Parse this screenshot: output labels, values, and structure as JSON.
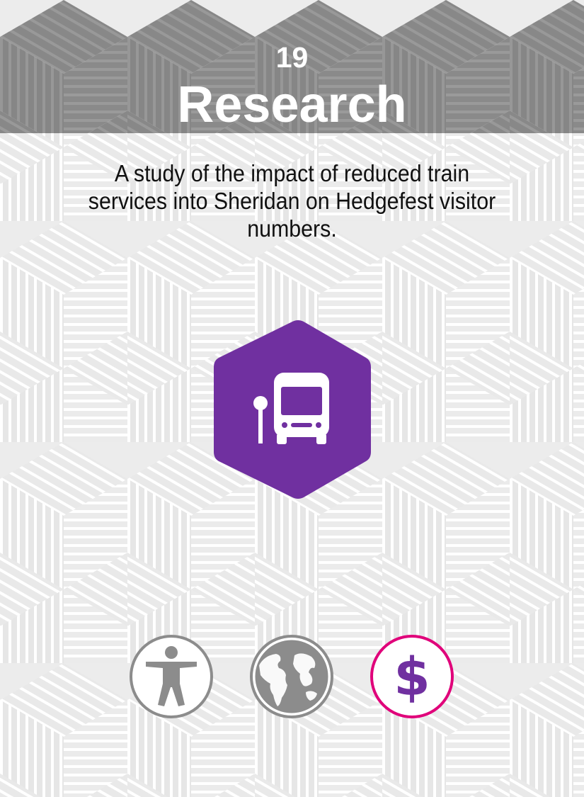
{
  "card": {
    "number": "19",
    "title": "Research",
    "description": "A study of the impact of reduced train services into Sheridan on Hedgefest visitor numbers."
  },
  "main_icon": {
    "name": "bus-stop-icon",
    "color": "#7030a0"
  },
  "category_icons": [
    {
      "name": "person-icon",
      "color": "#8c8c8c",
      "active": false
    },
    {
      "name": "globe-icon",
      "color": "#8c8c8c",
      "active": false
    },
    {
      "name": "dollar-icon",
      "color": "#e0007a",
      "glyph": "$",
      "glyph_color": "#7030a0",
      "active": true
    }
  ],
  "colors": {
    "header_bg": "#898989",
    "page_bg": "#ececec",
    "text": "#111111"
  }
}
